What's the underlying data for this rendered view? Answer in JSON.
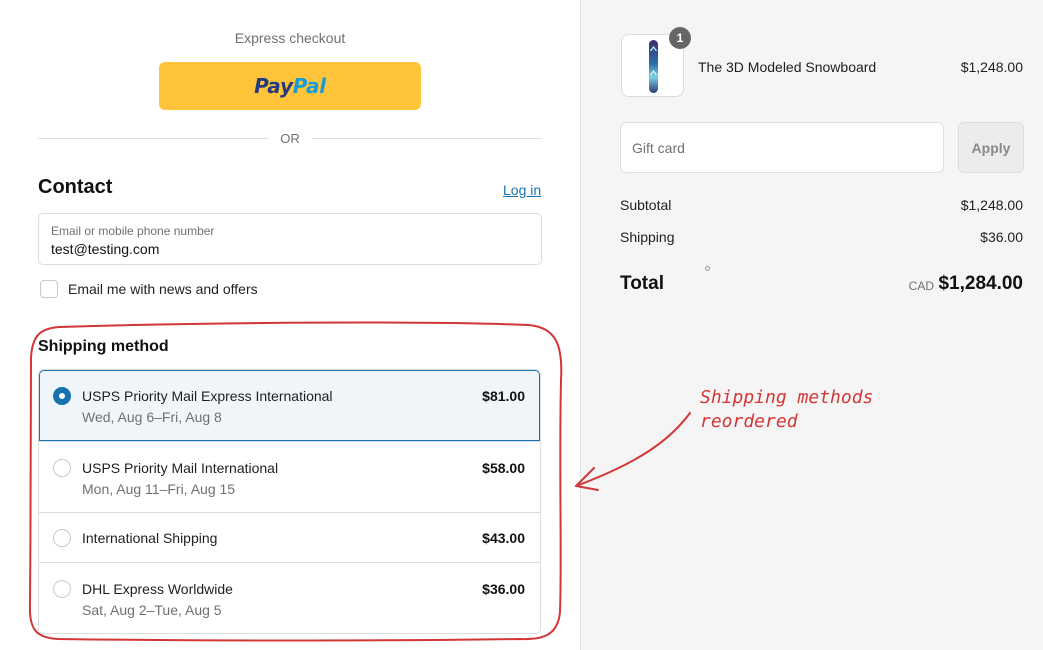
{
  "express": {
    "title": "Express checkout",
    "paypal_pay": "Pay",
    "paypal_pal": "Pal"
  },
  "divider": {
    "or": "OR"
  },
  "contact": {
    "title": "Contact",
    "login": "Log in",
    "email_label": "Email or mobile phone number",
    "email_value": "test@testing.com",
    "news_label": "Email me with news and offers",
    "news_checked": false
  },
  "shipping": {
    "title": "Shipping method",
    "options": [
      {
        "name": "USPS Priority Mail Express International",
        "date": "Wed, Aug 6–Fri, Aug 8",
        "price": "$81.00",
        "selected": true
      },
      {
        "name": "USPS Priority Mail International",
        "date": "Mon, Aug 11–Fri, Aug 15",
        "price": "$58.00",
        "selected": false
      },
      {
        "name": "International Shipping",
        "date": "",
        "price": "$43.00",
        "selected": false
      },
      {
        "name": "DHL Express Worldwide",
        "date": "Sat, Aug 2–Tue, Aug 5",
        "price": "$36.00",
        "selected": false
      }
    ]
  },
  "annotation": {
    "line1": "Shipping methods",
    "line2": "reordered",
    "color": "#d33636"
  },
  "summary": {
    "product": {
      "name": "The 3D Modeled Snowboard",
      "price": "$1,248.00",
      "quantity": "1"
    },
    "gift_card_placeholder": "Gift card",
    "apply_label": "Apply",
    "subtotal_label": "Subtotal",
    "subtotal_value": "$1,248.00",
    "shipping_label": "Shipping",
    "shipping_value": "$36.00",
    "total_label": "Total",
    "currency": "CAD",
    "total_value": "$1,284.00"
  },
  "colors": {
    "paypal_yellow": "#ffc439",
    "accent_blue": "#1773b0",
    "selected_bg": "#f0f5fa",
    "summary_bg": "#f5f5f5"
  }
}
